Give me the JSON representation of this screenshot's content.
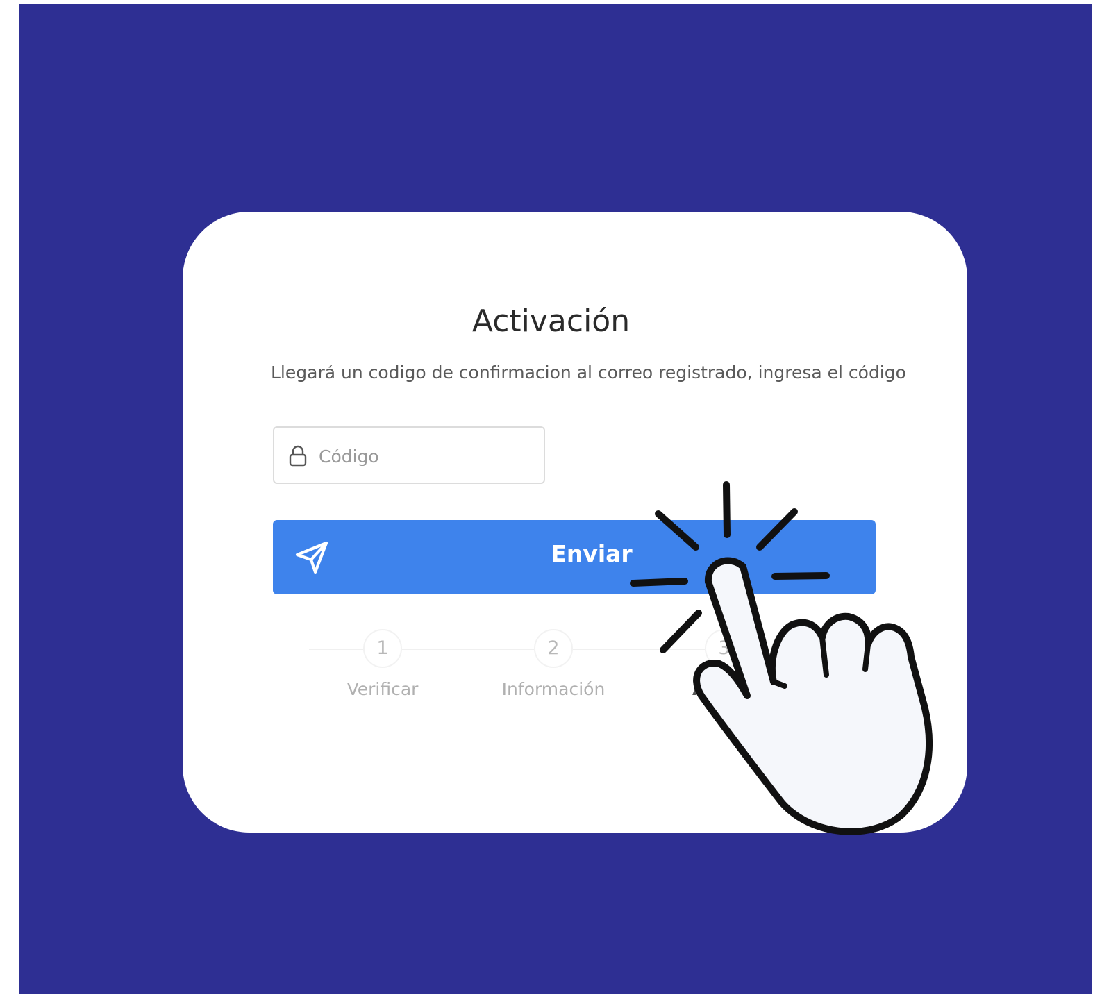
{
  "colors": {
    "background": "#2e2f93",
    "card": "#ffffff",
    "button": "#3e83ec",
    "title": "#2a2a2a",
    "subtitle": "#5a5a5a"
  },
  "form": {
    "title": "Activación",
    "subtitle": "Llegará un codigo de confirmacion al correo registrado, ingresa el código",
    "code_field": {
      "placeholder": "Código",
      "value": "",
      "icon": "lock-icon"
    },
    "submit_button": {
      "label": "Enviar",
      "icon": "send-icon"
    }
  },
  "steps": [
    {
      "number": "1",
      "label": "Verificar"
    },
    {
      "number": "2",
      "label": "Información"
    },
    {
      "number": "3",
      "label": "Activación"
    }
  ],
  "overlay": {
    "icon": "pointer-hand-click-icon"
  }
}
